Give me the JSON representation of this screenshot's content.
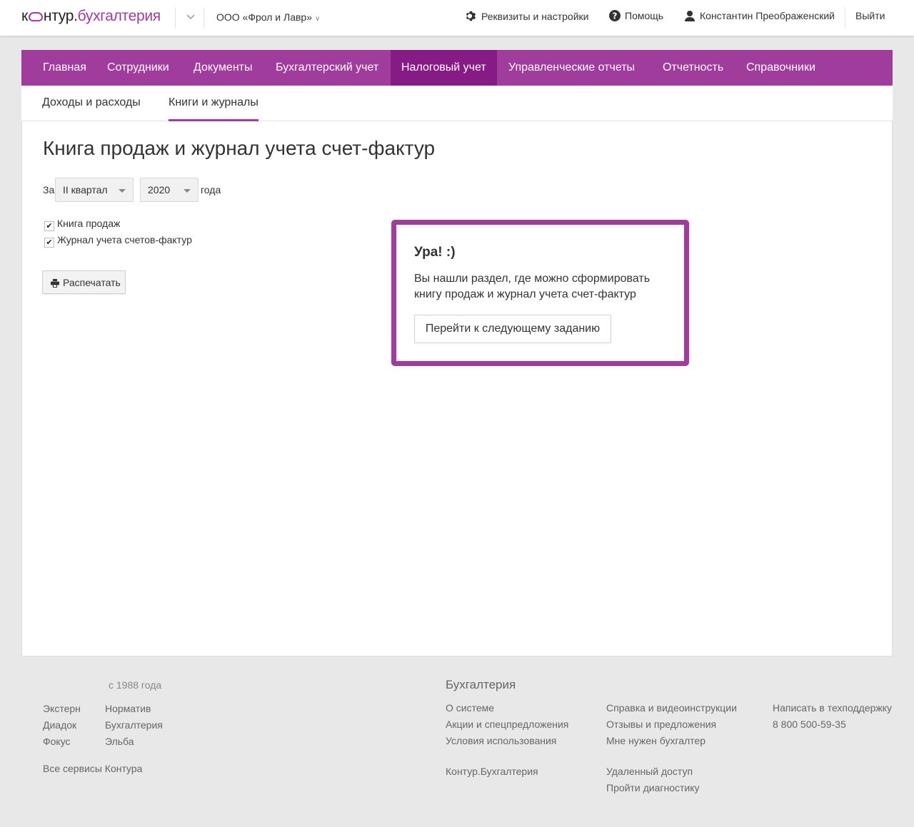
{
  "topbar": {
    "logo_prefix": "к",
    "logo_main": "нтур.",
    "logo_brand": "бухгалтерия",
    "org_name": "ООО «Фрол и Лавр»",
    "settings_label": "Реквизиты и настройки",
    "help_label": "Помощь",
    "user_name": "Константин Преображенский",
    "logout_label": "Выйти"
  },
  "main_nav": {
    "items": [
      "Главная",
      "Сотрудники",
      "Документы",
      "Бухгалтерский учет",
      "Налоговый учет",
      "Управленческие отчеты",
      "Отчетность",
      "Справочники"
    ],
    "active": "Налоговый учет"
  },
  "sub_nav": {
    "items": [
      "Доходы и расходы",
      "Книги и журналы"
    ],
    "active": "Книги и журналы"
  },
  "page": {
    "title": "Книга продаж и журнал учета счет-фактур",
    "period_prefix": "За",
    "quarter_value": "II квартал",
    "year_value": "2020",
    "period_suffix": "года",
    "checkbox_sales_book": "Книга продаж",
    "checkbox_invoice_journal": "Журнал учета счетов-фактур",
    "sales_book_checked": true,
    "invoice_journal_checked": true,
    "print_label": "Распечатать"
  },
  "popup": {
    "title": "Ура! :)",
    "text": "Вы нашли раздел, где можно сформировать книгу продаж и журнал учета счет-фактур",
    "button_label": "Перейти к следующему заданию"
  },
  "footer": {
    "since": "с 1988 года",
    "services_col1": [
      "Экстерн",
      "Диадок",
      "Фокус"
    ],
    "services_col2": [
      "Норматив",
      "Бухгалтерия",
      "Эльба"
    ],
    "all_services": "Все сервисы Контура",
    "section_title": "Бухгалтерия",
    "col_a": [
      "О системе",
      "Акции и спецпредложения",
      "Условия использования"
    ],
    "col_a_extra": "Контур.Бухгалтерия",
    "col_b": [
      "Справка и видеоинструкции",
      "Отзывы и предложения",
      "Мне нужен бухгалтер"
    ],
    "col_b_extra": [
      "Удаленный доступ",
      "Пройти диагностику"
    ],
    "support_label": "Написать в техподдержку",
    "support_phone": "8 800 500-59-35"
  },
  "colors": {
    "brand": "#a03c9c",
    "brand_active": "#861b86"
  }
}
